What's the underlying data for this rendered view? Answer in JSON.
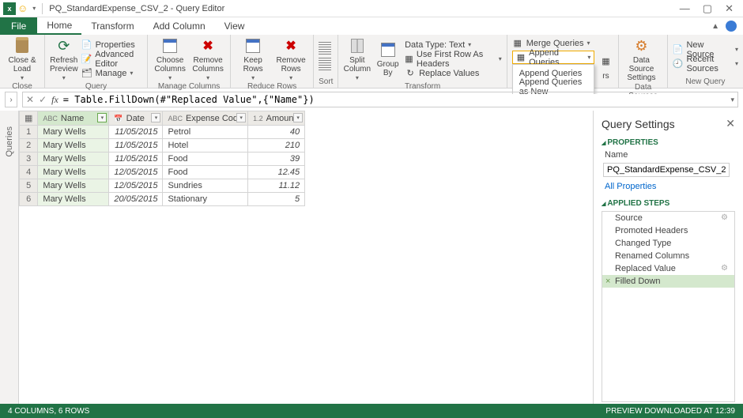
{
  "title": "PQ_StandardExpense_CSV_2 - Query Editor",
  "tabs": {
    "file": "File",
    "home": "Home",
    "transform": "Transform",
    "addcol": "Add Column",
    "view": "View"
  },
  "ribbon": {
    "close_load": "Close &\nLoad",
    "refresh": "Refresh\nPreview",
    "properties": "Properties",
    "adv_editor": "Advanced Editor",
    "manage": "Manage",
    "choose_cols": "Choose\nColumns",
    "remove_cols": "Remove\nColumns",
    "keep_rows": "Keep\nRows",
    "remove_rows": "Remove\nRows",
    "split_col": "Split\nColumn",
    "group_by": "Group\nBy",
    "datatype": "Data Type: Text",
    "first_row": "Use First Row As Headers",
    "replace": "Replace Values",
    "merge_q": "Merge Queries",
    "append_q": "Append Queries",
    "append_q2": "Append Queries",
    "append_new": "Append Queries as New",
    "ds_settings": "Data Source\nSettings",
    "new_source": "New Source",
    "recent": "Recent Sources",
    "g_close": "Close",
    "g_query": "Query",
    "g_mcols": "Manage Columns",
    "g_rrows": "Reduce Rows",
    "g_sort": "Sort",
    "g_trans": "Transform",
    "g_combine": "rs",
    "g_ds": "Data Sources",
    "g_nq": "New Query"
  },
  "formula": "= Table.FillDown(#\"Replaced Value\",{\"Name\"})",
  "queries_label": "Queries",
  "columns": [
    "",
    "Name",
    "Date",
    "Expense Code",
    "Amount"
  ],
  "col_types": [
    "",
    "ABC",
    "📅",
    "ABC",
    "1.2"
  ],
  "rows": [
    {
      "n": "1",
      "name": "Mary Wells",
      "date": "11/05/2015",
      "code": "Petrol",
      "amt": "40"
    },
    {
      "n": "2",
      "name": "Mary Wells",
      "date": "11/05/2015",
      "code": "Hotel",
      "amt": "210"
    },
    {
      "n": "3",
      "name": "Mary Wells",
      "date": "11/05/2015",
      "code": "Food",
      "amt": "39"
    },
    {
      "n": "4",
      "name": "Mary Wells",
      "date": "12/05/2015",
      "code": "Food",
      "amt": "12.45"
    },
    {
      "n": "5",
      "name": "Mary Wells",
      "date": "12/05/2015",
      "code": "Sundries",
      "amt": "11.12"
    },
    {
      "n": "6",
      "name": "Mary Wells",
      "date": "20/05/2015",
      "code": "Stationary",
      "amt": "5"
    }
  ],
  "settings": {
    "title": "Query Settings",
    "props": "PROPERTIES",
    "name_lbl": "Name",
    "name_val": "PQ_StandardExpense_CSV_2",
    "all_props": "All Properties",
    "applied": "APPLIED STEPS",
    "steps": [
      "Source",
      "Promoted Headers",
      "Changed Type",
      "Renamed Columns",
      "Replaced Value",
      "Filled Down"
    ],
    "step_gears": [
      true,
      false,
      false,
      false,
      true,
      false
    ]
  },
  "status": {
    "left": "4 COLUMNS, 6 ROWS",
    "right": "PREVIEW DOWNLOADED AT 12:39"
  }
}
